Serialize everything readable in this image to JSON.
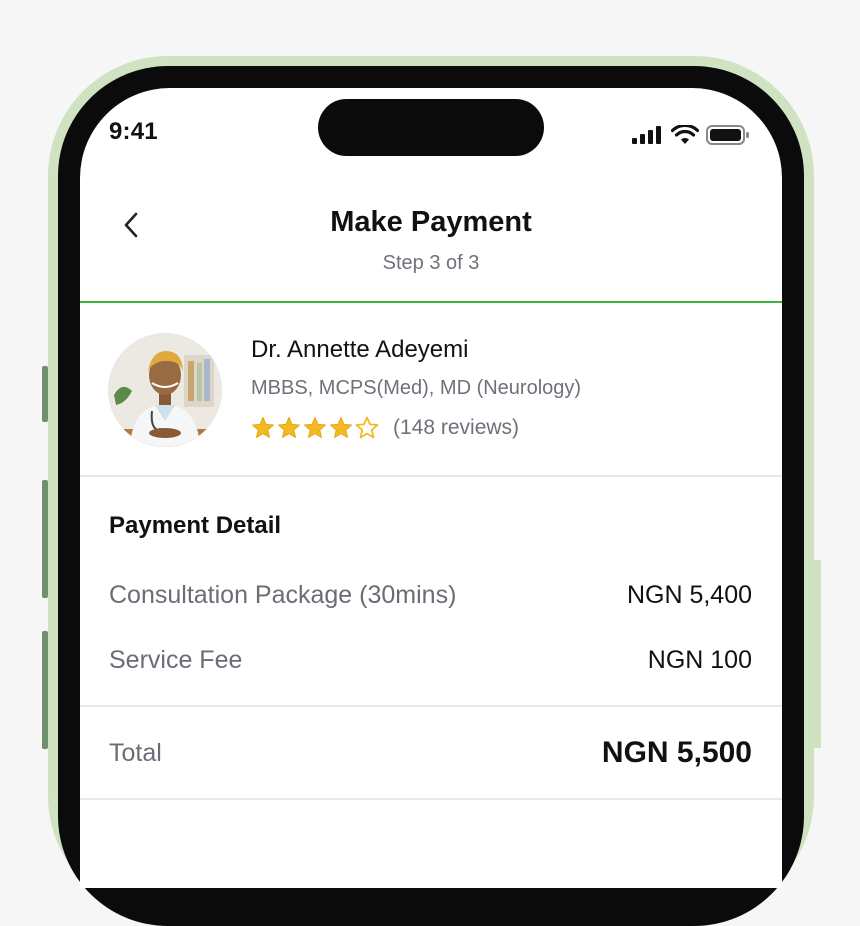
{
  "status_bar": {
    "time": "9:41"
  },
  "header": {
    "back_icon": "chevron-left-icon",
    "title": "Make Payment",
    "subtitle": "Step 3 of 3"
  },
  "doctor": {
    "name": "Dr. Annette Adeyemi",
    "credentials": "MBBS, MCPS(Med), MD (Neurology)",
    "rating": 4,
    "rating_max": 5,
    "reviews": "(148 reviews)"
  },
  "payment": {
    "section_title": "Payment Detail",
    "items": [
      {
        "label": "Consultation Package (30mins)",
        "value": "NGN 5,400"
      },
      {
        "label": "Service Fee",
        "value": "NGN 100"
      }
    ],
    "total_label": "Total",
    "total_value": "NGN 5,500"
  },
  "colors": {
    "accent_green": "#3db43a",
    "star": "#f5b921",
    "phone_frame": "#cfe3c3"
  }
}
